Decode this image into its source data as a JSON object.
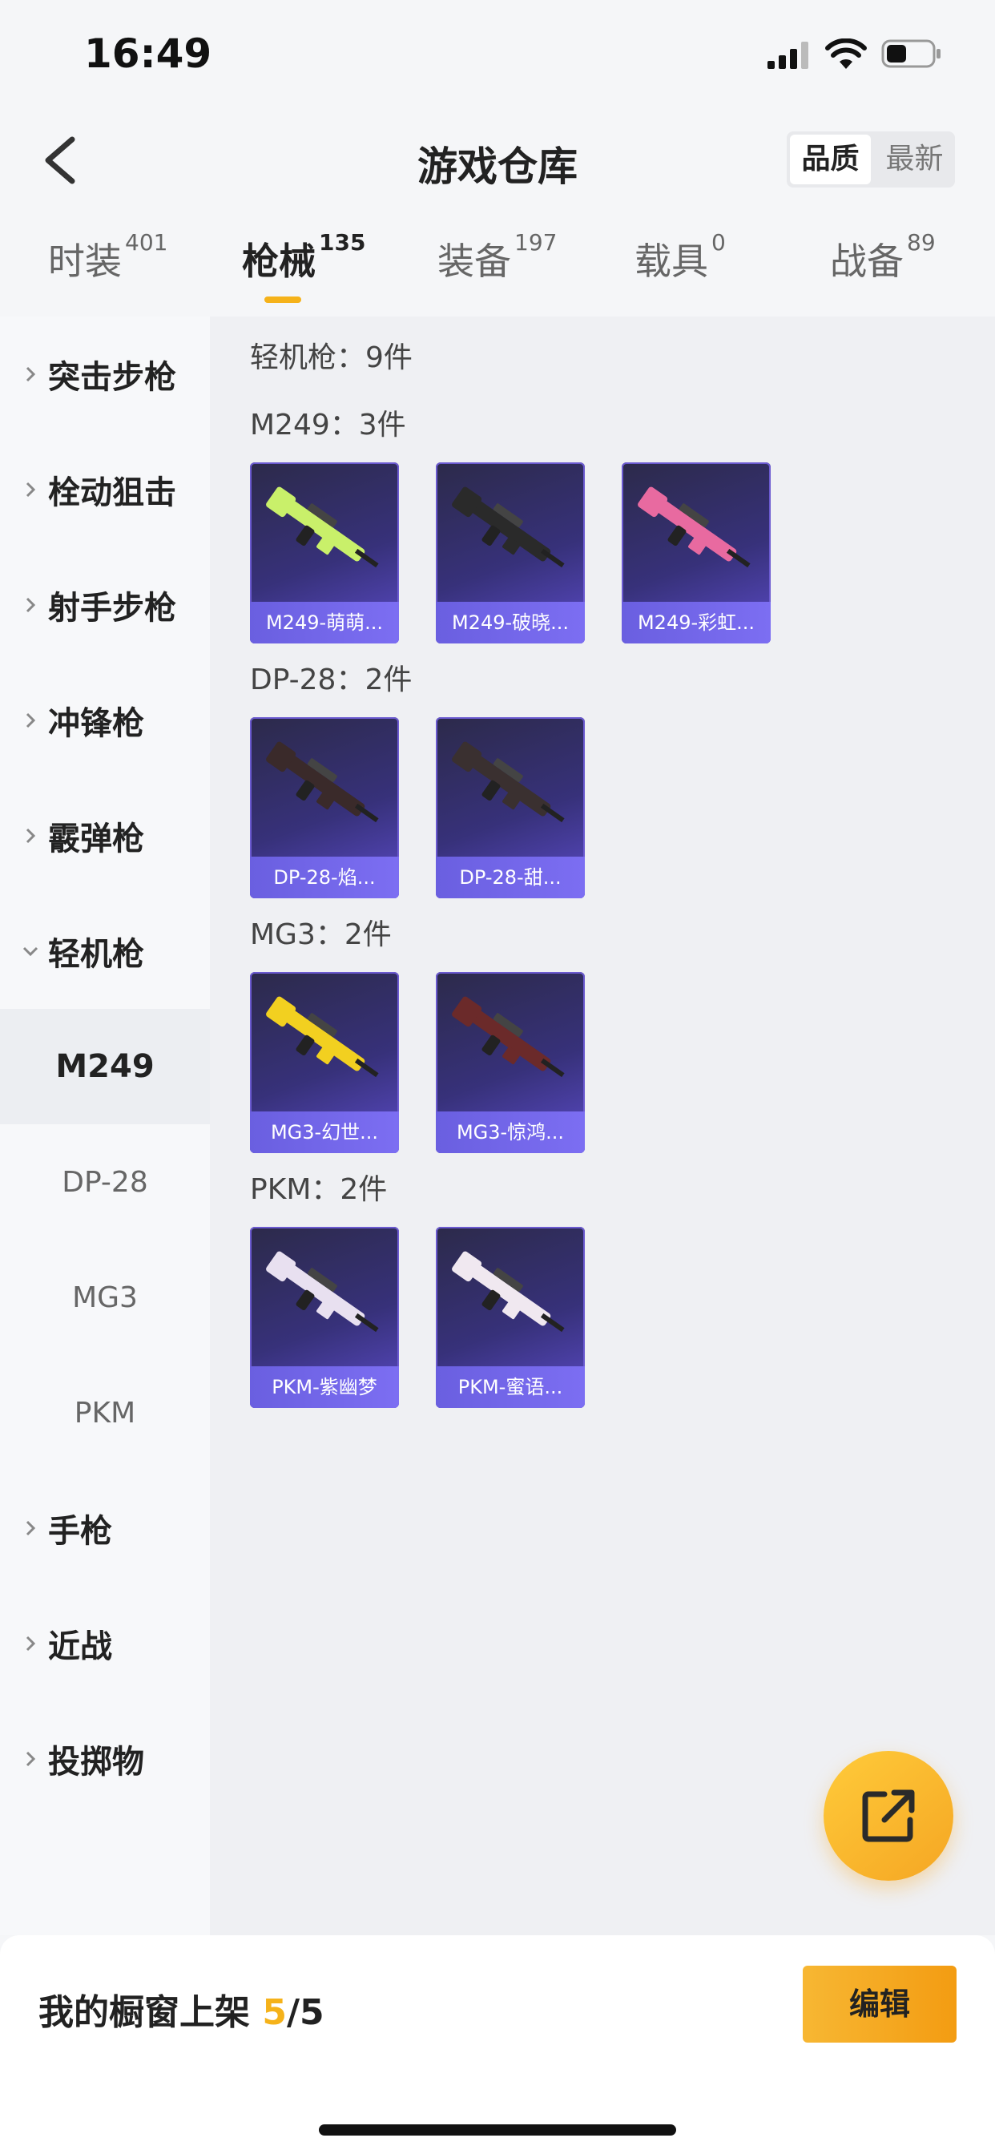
{
  "status": {
    "time": "16:49"
  },
  "header": {
    "title": "游戏仓库",
    "sort_quality": "品质",
    "sort_newest": "最新"
  },
  "tabs": [
    {
      "label": "时装",
      "count": "401"
    },
    {
      "label": "枪械",
      "count": "135"
    },
    {
      "label": "装备",
      "count": "197"
    },
    {
      "label": "载具",
      "count": "0"
    },
    {
      "label": "战备",
      "count": "89"
    }
  ],
  "sidebar": {
    "categories": [
      {
        "label": "突击步枪"
      },
      {
        "label": "栓动狙击"
      },
      {
        "label": "射手步枪"
      },
      {
        "label": "冲锋枪"
      },
      {
        "label": "霰弹枪"
      },
      {
        "label": "轻机枪"
      },
      {
        "label": "手枪"
      },
      {
        "label": "近战"
      },
      {
        "label": "投掷物"
      }
    ],
    "subcategories": [
      {
        "label": "M249"
      },
      {
        "label": "DP-28"
      },
      {
        "label": "MG3"
      },
      {
        "label": "PKM"
      }
    ]
  },
  "content": {
    "section_title": "轻机枪：9件",
    "groups": [
      {
        "title": "M249：3件",
        "items": [
          "M249-萌萌...",
          "M249-破晓...",
          "M249-彩虹..."
        ]
      },
      {
        "title": "DP-28：2件",
        "items": [
          "DP-28-焰...",
          "DP-28-甜..."
        ]
      },
      {
        "title": "MG3：2件",
        "items": [
          "MG3-幻世...",
          "MG3-惊鸿..."
        ]
      },
      {
        "title": "PKM：2件",
        "items": [
          "PKM-紫幽梦",
          "PKM-蜜语..."
        ]
      }
    ]
  },
  "bottom_bar": {
    "label": "我的橱窗上架",
    "current": "5",
    "total": "/5",
    "edit": "编辑"
  },
  "colors": {
    "accent": "#f5b21a",
    "card_purple": "#5b4bc8"
  },
  "gun_colors": [
    "#c9f06a",
    "#2a2a2a",
    "#e86aa0",
    "#3a2a2a",
    "#3a3030",
    "#f2d020",
    "#6b2a2a",
    "#e8e0f0",
    "#f0e8f0"
  ]
}
